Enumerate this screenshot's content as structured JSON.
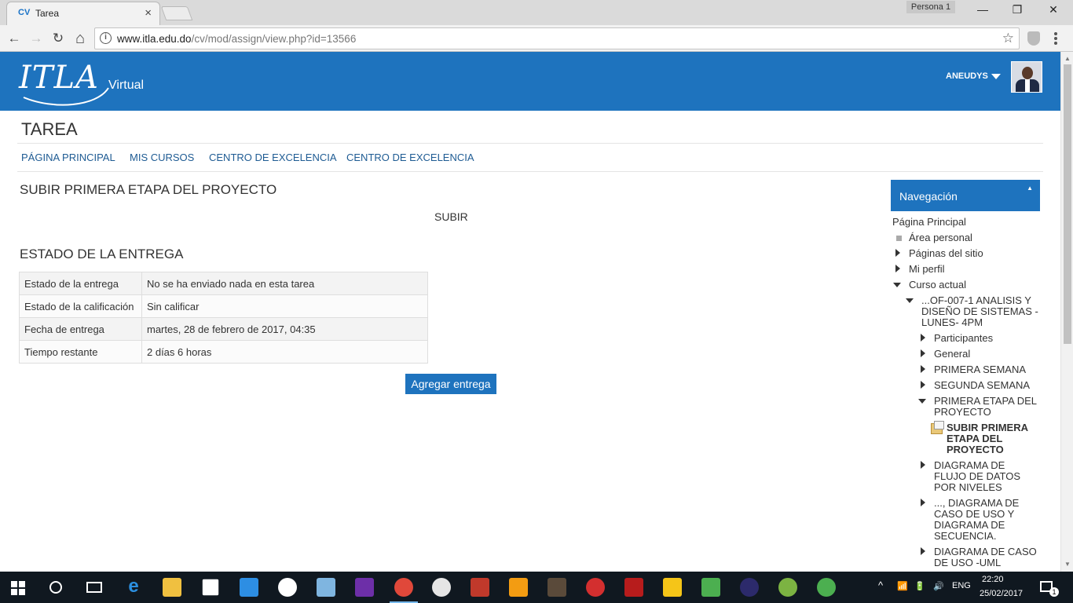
{
  "browser": {
    "tab_favicon": "CV",
    "tab_title": "Tarea",
    "tab_close": "×",
    "profile": "Persona 1",
    "url_domain": "www.itla.edu.do",
    "url_path": "/cv/mod/assign/view.php?id=13566",
    "info_icon": "i",
    "bookmark_icon": "☆",
    "win_min": "—",
    "win_max": "❐",
    "win_close": "✕",
    "back": "←",
    "forward": "→",
    "reload": "↻",
    "home": "⌂"
  },
  "site": {
    "logo_text": "ITLA",
    "logo_sub": "Virtual",
    "user_name": "ANEUDYS"
  },
  "page": {
    "title": "TAREA",
    "nav": [
      "PÁGINA PRINCIPAL",
      "MIS CURSOS",
      "CENTRO DE EXCELENCIA",
      "CENTRO DE EXCELENCIA"
    ],
    "assignment_title": "SUBIR PRIMERA ETAPA DEL PROYECTO",
    "assignment_intro": "SUBIR",
    "status_heading": "ESTADO DE LA ENTREGA",
    "status_rows": [
      {
        "label": "Estado de la entrega",
        "value": "No se ha enviado nada en esta tarea"
      },
      {
        "label": "Estado de la calificación",
        "value": "Sin calificar"
      },
      {
        "label": "Fecha de entrega",
        "value": "martes, 28 de febrero de 2017, 04:35"
      },
      {
        "label": "Tiempo restante",
        "value": "2 días 6 horas"
      }
    ],
    "add_submission_label": "Agregar entrega"
  },
  "navigation": {
    "title": "Navegación",
    "collapse_icon": "▲",
    "home": "Página Principal",
    "area_personal": "Área personal",
    "paginas_sitio": "Páginas del sitio",
    "mi_perfil": "Mi perfil",
    "curso_actual": "Curso actual",
    "course_name": "...OF-007-1 ANALISIS Y DISEÑO DE SISTEMAS - LUNES- 4PM",
    "participantes": "Participantes",
    "general": "General",
    "primera_semana": "PRIMERA SEMANA",
    "segunda_semana": "SEGUNDA SEMANA",
    "primera_etapa": "PRIMERA ETAPA DEL PROYECTO",
    "current_item": "SUBIR PRIMERA ETAPA DEL PROYECTO",
    "diagrama_flujo": "DIAGRAMA DE FLUJO DE DATOS POR NIVELES",
    "diagrama_caso_seq": "..., DIAGRAMA DE CASO DE USO Y DIAGRAMA DE SECUENCIA.",
    "diagrama_caso_uml": "DIAGRAMA DE CASO DE USO -UML"
  },
  "taskbar": {
    "lang": "ENG",
    "time": "22:20",
    "date": "25/02/2017",
    "notification_count": "1"
  }
}
